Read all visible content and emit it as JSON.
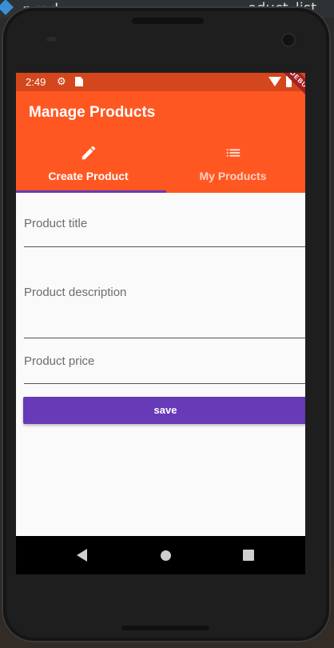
{
  "ide": {
    "top_left_text": "prod",
    "top_right_text": "oduct_list"
  },
  "status_bar": {
    "time": "2:49"
  },
  "debug_banner": "DEBUG",
  "app_bar": {
    "title": "Manage Products"
  },
  "tabs": [
    {
      "label": "Create Product",
      "icon": "pencil-icon",
      "selected": true
    },
    {
      "label": "My Products",
      "icon": "list-icon",
      "selected": false
    }
  ],
  "form": {
    "title_placeholder": "Product title",
    "description_placeholder": "Product description",
    "price_placeholder": "Product price",
    "save_label": "save"
  },
  "colors": {
    "app_bar": "#ff5722",
    "status_bar": "#d4461c",
    "accent": "#673ab7"
  }
}
